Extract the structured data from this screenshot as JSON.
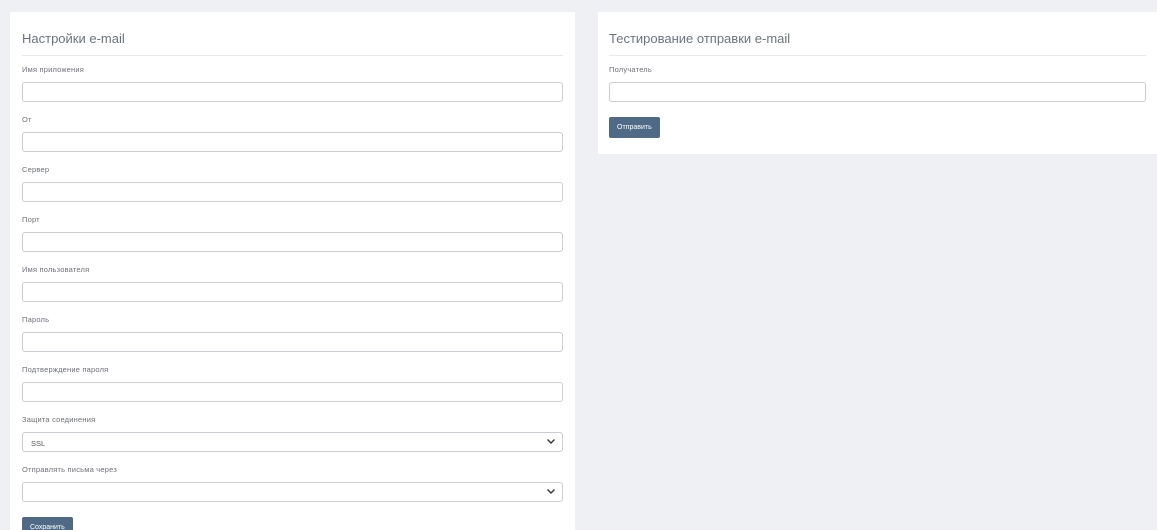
{
  "email_settings": {
    "title": "Настройки e-mail",
    "fields": {
      "app_name": {
        "label": "Имя приложения",
        "value": ""
      },
      "from": {
        "label": "От",
        "value": ""
      },
      "server": {
        "label": "Сервер",
        "value": ""
      },
      "port": {
        "label": "Порт",
        "value": ""
      },
      "username": {
        "label": "Имя пользователя",
        "value": ""
      },
      "password": {
        "label": "Пароль",
        "value": ""
      },
      "password_confirm": {
        "label": "Подтверждение пароля",
        "value": ""
      },
      "connection_security": {
        "label": "Защита соединения",
        "selected": "SSL"
      },
      "send_via": {
        "label": "Отправлять письма через",
        "selected": ""
      }
    },
    "save_label": "Сохранить"
  },
  "email_test": {
    "title": "Тестирование отправки e-mail",
    "recipient": {
      "label": "Получатель",
      "value": ""
    },
    "send_label": "Отправить"
  },
  "colors": {
    "page_background": "#eef0f3",
    "panel_background": "#ffffff",
    "button": "#4f6a86",
    "input_border": "#c9ccd1"
  },
  "icons": {
    "select_arrow": "chevron-down-icon"
  }
}
